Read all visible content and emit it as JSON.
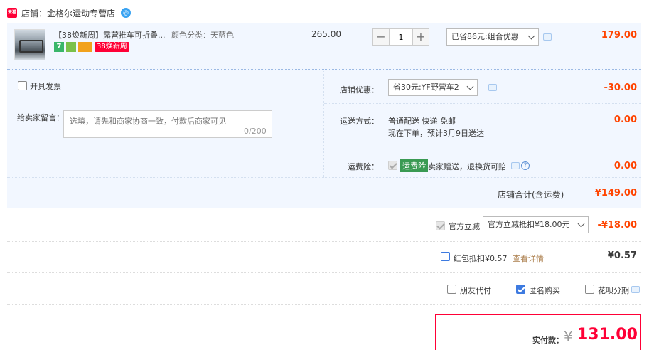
{
  "shop": {
    "badge": "天猫",
    "name": "店铺：金格尔运动专营店",
    "ww": "@"
  },
  "item": {
    "title": "【38焕新周】露营推车可折叠...",
    "sku": "颜色分类：天蓝色",
    "tags": [
      "7",
      "",
      "",
      "38焕新周"
    ],
    "unit_price": "265.00",
    "quantity": "1",
    "minus": "−",
    "plus": "+",
    "promo_select": "已省86元:组合优惠",
    "subtotal": "179.00"
  },
  "invoice": {
    "label": "开具发票",
    "checked": false
  },
  "message": {
    "label": "给卖家留言：",
    "placeholder": "选填，请先和商家协商一致，付款后商家可见",
    "counter": "0/200"
  },
  "shop_discount": {
    "label": "店铺优惠：",
    "select": "省30元:YF野营车2",
    "amount": "-30.00"
  },
  "shipping": {
    "label": "运送方式：",
    "method": "普通配送 快递 免邮",
    "eta": "现在下单，预计3月9日送达",
    "amount": "0.00"
  },
  "insurance": {
    "label": "运费险：",
    "badge": "运费险",
    "desc": "卖家赠送，退换货可赔",
    "help": "?",
    "amount": "0.00"
  },
  "shop_total": {
    "label": "店铺合计(含运费)",
    "amount": "¥149.00"
  },
  "official_discount": {
    "label": "官方立减",
    "select": "官方立减抵扣¥18.00元",
    "amount": "-¥18.00"
  },
  "red_packet": {
    "label": "红包抵扣¥0.57",
    "link": "查看详情",
    "amount": "¥0.57"
  },
  "options": {
    "friend_pay": "朋友代付",
    "anonymous": "匿名购买",
    "huabei": "花呗分期"
  },
  "pay": {
    "label": "实付款：",
    "currency": "¥",
    "amount": "131.00"
  },
  "colors": {
    "accent": "#ff0036",
    "price": "#ff4400",
    "blue_bg": "#f2f7ff"
  }
}
